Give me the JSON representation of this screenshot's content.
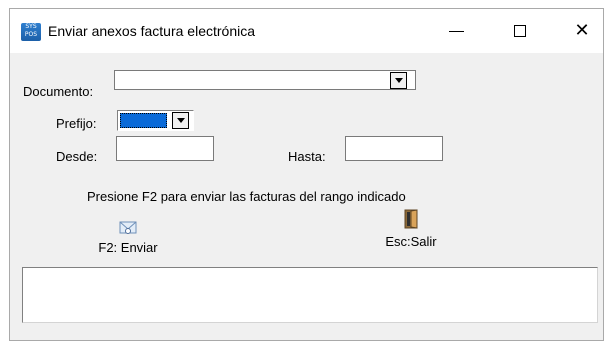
{
  "window": {
    "title": "Enviar anexos factura electrónica",
    "controls": {
      "minimize": "minimize",
      "maximize": "maximize",
      "close": "close"
    }
  },
  "form": {
    "documento_label": "Documento:",
    "documento_value": "",
    "prefijo_label": "Prefijo:",
    "prefijo_value": "",
    "desde_label": "Desde:",
    "desde_value": "",
    "hasta_label": "Hasta:",
    "hasta_value": ""
  },
  "hint": "Presione F2 para enviar las facturas del rango indicado",
  "toolbar": {
    "send_label": "F2: Enviar",
    "exit_label": "Esc:Salir"
  },
  "log": {
    "text": ""
  },
  "colors": {
    "selection": "#0a6ad8",
    "title_bg": "#ffffff",
    "dialog_bg": "#f0f0f0"
  },
  "icons": {
    "app": "app-logo-icon",
    "send": "mail-icon",
    "exit": "door-exit-icon"
  }
}
